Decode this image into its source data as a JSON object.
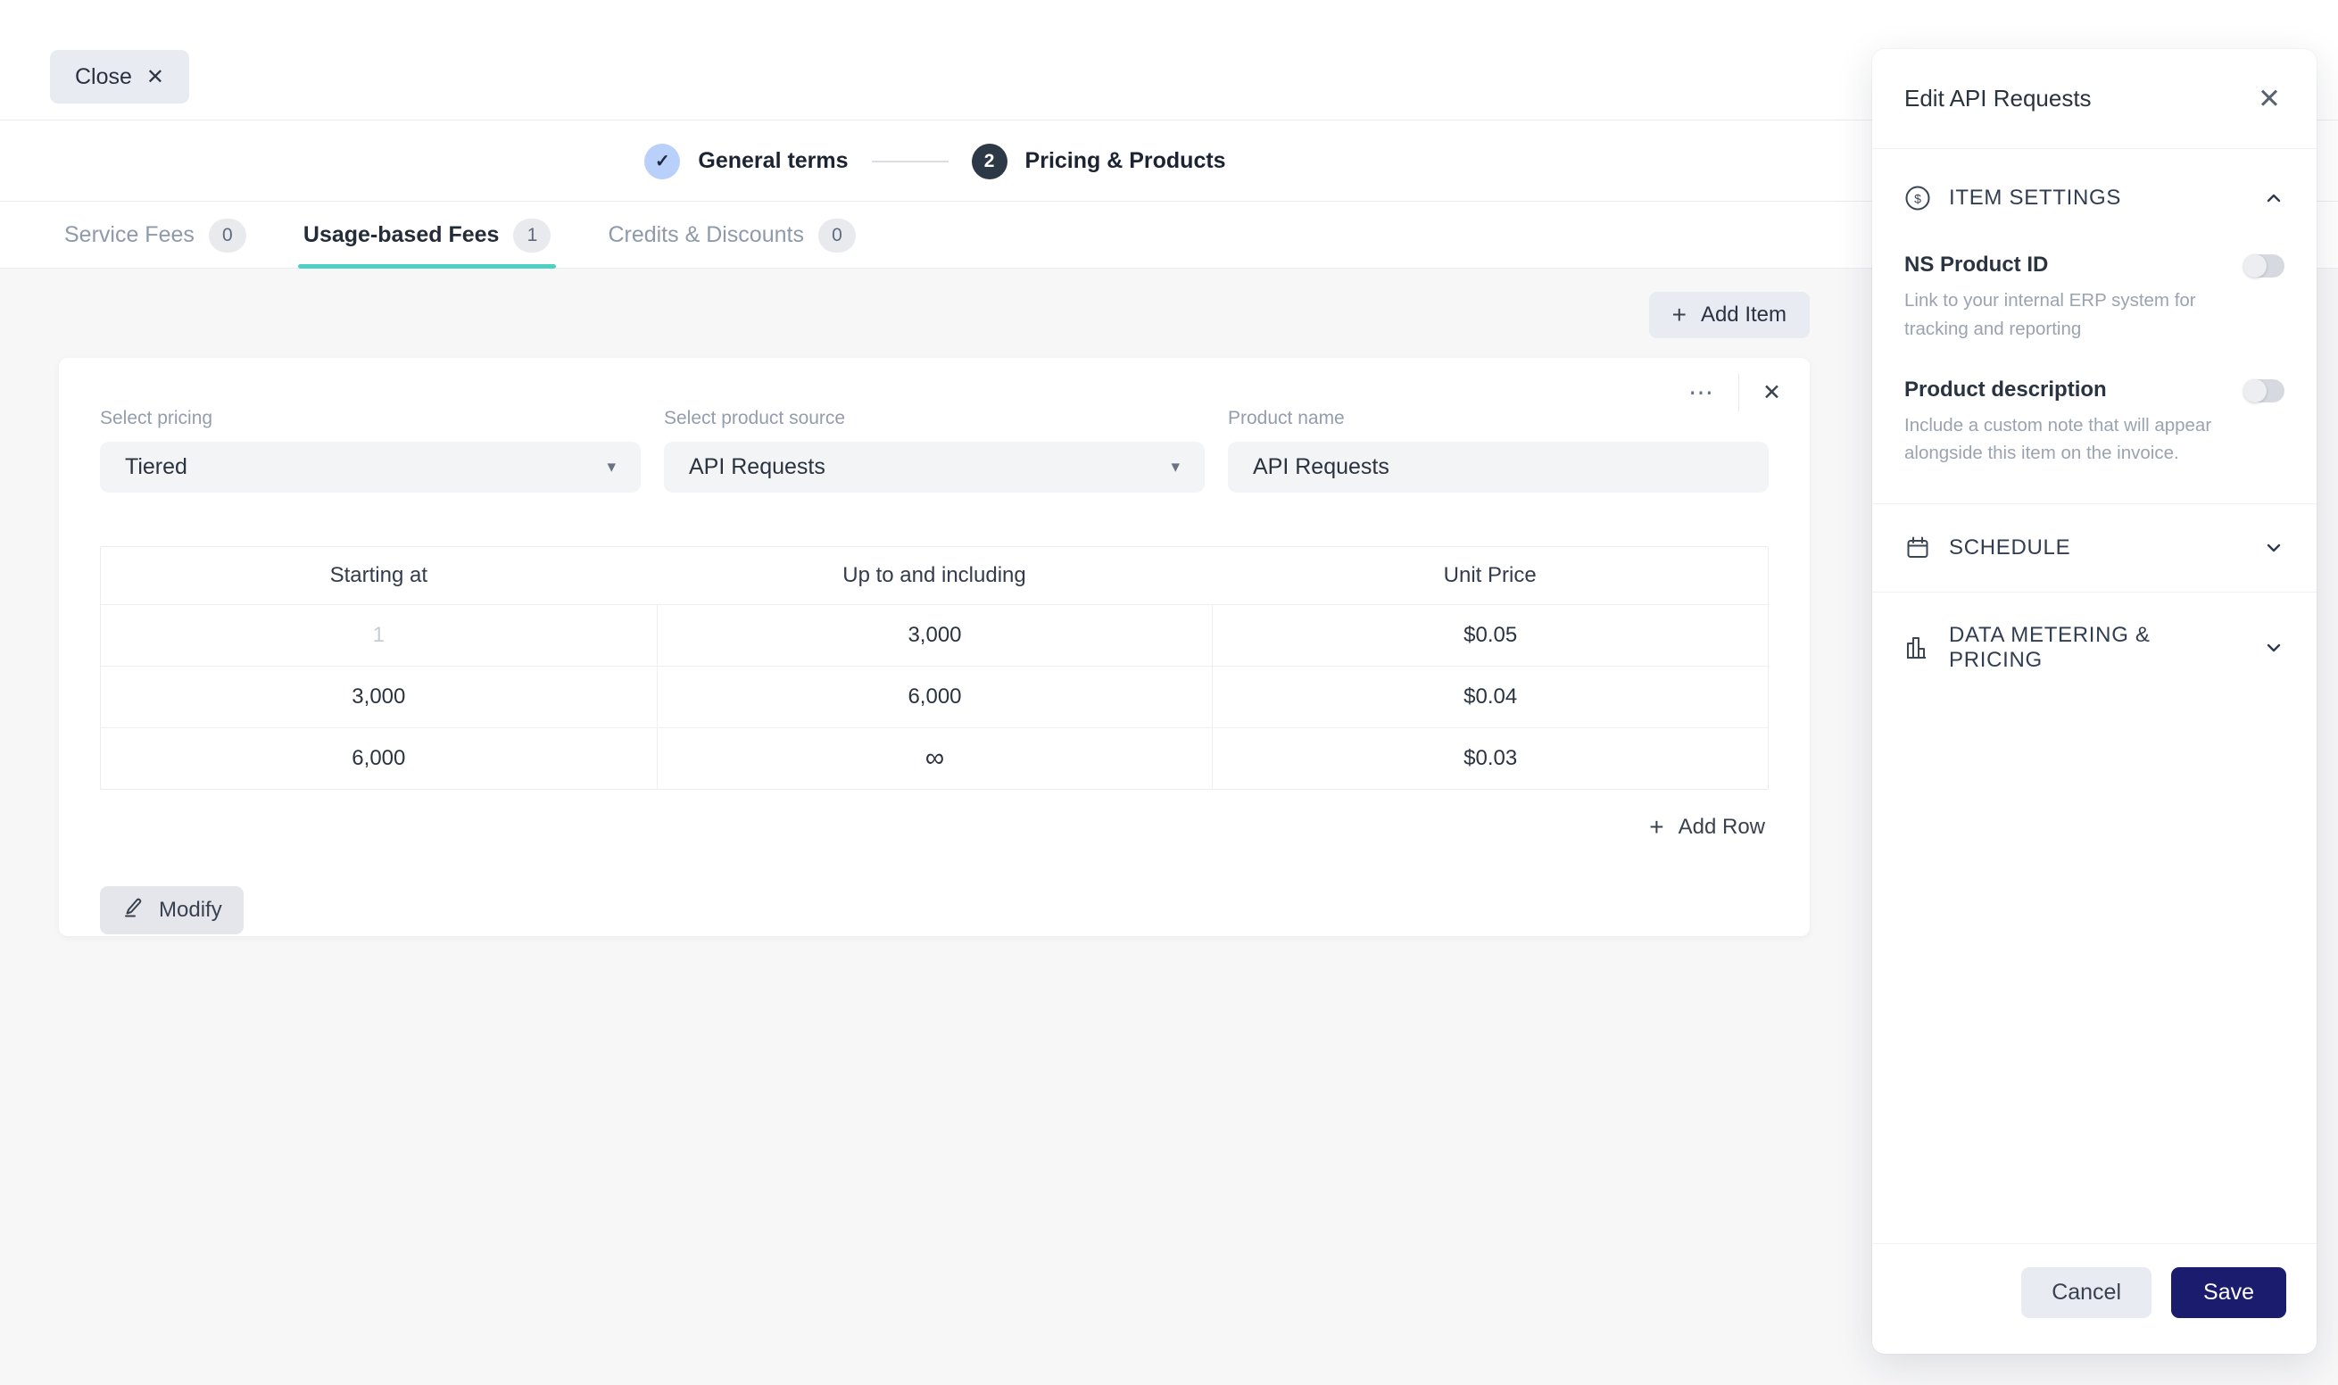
{
  "window": {
    "close_label": "Close"
  },
  "icons": {
    "close": "✕",
    "check": "✓",
    "plus": "+",
    "ellipsis": "⋯",
    "caret_down": "▾",
    "dollar": "$"
  },
  "stepper": {
    "steps": [
      {
        "label": "General terms",
        "state": "done"
      },
      {
        "label": "Pricing & Products",
        "number": "2",
        "state": "active"
      }
    ]
  },
  "tabs": [
    {
      "label": "Service Fees",
      "count": "0",
      "active": false
    },
    {
      "label": "Usage-based Fees",
      "count": "1",
      "active": true
    },
    {
      "label": "Credits & Discounts",
      "count": "0",
      "active": false
    }
  ],
  "toolbar": {
    "add_item_label": "Add Item"
  },
  "item_card": {
    "fields": [
      {
        "label": "Select pricing",
        "value": "Tiered",
        "type": "select"
      },
      {
        "label": "Select product source",
        "value": "API Requests",
        "type": "select"
      },
      {
        "label": "Product name",
        "value": "API Requests",
        "type": "input"
      }
    ],
    "table": {
      "columns": [
        "Starting at",
        "Up to and including",
        "Unit Price"
      ],
      "rows": [
        [
          "1",
          "3,000",
          "$0.05"
        ],
        [
          "3,000",
          "6,000",
          "$0.04"
        ],
        [
          "6,000",
          "∞",
          "$0.03"
        ]
      ]
    },
    "add_row_label": "Add Row",
    "modify_label": "Modify"
  },
  "panel": {
    "title": "Edit API Requests",
    "sections": {
      "item_settings": {
        "title": "ITEM SETTINGS",
        "expanded": true,
        "items": [
          {
            "title": "NS Product ID",
            "description": "Link to your internal ERP system for tracking and reporting",
            "enabled": false
          },
          {
            "title": "Product description",
            "description": "Include a custom note that will appear alongside this item on the invoice.",
            "enabled": false
          }
        ]
      },
      "schedule": {
        "title": "SCHEDULE",
        "expanded": false
      },
      "data_metering": {
        "title": "DATA METERING & PRICING",
        "expanded": false
      }
    },
    "cancel_label": "Cancel",
    "save_label": "Save"
  },
  "colors": {
    "accent_teal": "#4ed0c4",
    "save_bg": "#1c1c6e",
    "step_done_bg": "#b9d0fa",
    "step_active_bg": "#2e3947",
    "content_bg": "#f7f7f8"
  }
}
